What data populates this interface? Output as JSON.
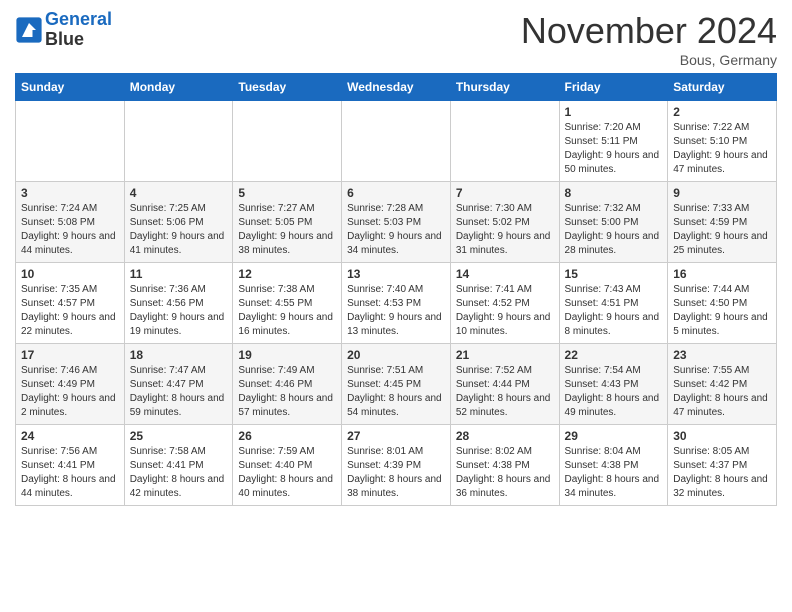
{
  "header": {
    "logo_line1": "General",
    "logo_line2": "Blue",
    "title": "November 2024",
    "location": "Bous, Germany"
  },
  "weekdays": [
    "Sunday",
    "Monday",
    "Tuesday",
    "Wednesday",
    "Thursday",
    "Friday",
    "Saturday"
  ],
  "weeks": [
    [
      {
        "day": "",
        "info": ""
      },
      {
        "day": "",
        "info": ""
      },
      {
        "day": "",
        "info": ""
      },
      {
        "day": "",
        "info": ""
      },
      {
        "day": "",
        "info": ""
      },
      {
        "day": "1",
        "info": "Sunrise: 7:20 AM\nSunset: 5:11 PM\nDaylight: 9 hours and 50 minutes."
      },
      {
        "day": "2",
        "info": "Sunrise: 7:22 AM\nSunset: 5:10 PM\nDaylight: 9 hours and 47 minutes."
      }
    ],
    [
      {
        "day": "3",
        "info": "Sunrise: 7:24 AM\nSunset: 5:08 PM\nDaylight: 9 hours and 44 minutes."
      },
      {
        "day": "4",
        "info": "Sunrise: 7:25 AM\nSunset: 5:06 PM\nDaylight: 9 hours and 41 minutes."
      },
      {
        "day": "5",
        "info": "Sunrise: 7:27 AM\nSunset: 5:05 PM\nDaylight: 9 hours and 38 minutes."
      },
      {
        "day": "6",
        "info": "Sunrise: 7:28 AM\nSunset: 5:03 PM\nDaylight: 9 hours and 34 minutes."
      },
      {
        "day": "7",
        "info": "Sunrise: 7:30 AM\nSunset: 5:02 PM\nDaylight: 9 hours and 31 minutes."
      },
      {
        "day": "8",
        "info": "Sunrise: 7:32 AM\nSunset: 5:00 PM\nDaylight: 9 hours and 28 minutes."
      },
      {
        "day": "9",
        "info": "Sunrise: 7:33 AM\nSunset: 4:59 PM\nDaylight: 9 hours and 25 minutes."
      }
    ],
    [
      {
        "day": "10",
        "info": "Sunrise: 7:35 AM\nSunset: 4:57 PM\nDaylight: 9 hours and 22 minutes."
      },
      {
        "day": "11",
        "info": "Sunrise: 7:36 AM\nSunset: 4:56 PM\nDaylight: 9 hours and 19 minutes."
      },
      {
        "day": "12",
        "info": "Sunrise: 7:38 AM\nSunset: 4:55 PM\nDaylight: 9 hours and 16 minutes."
      },
      {
        "day": "13",
        "info": "Sunrise: 7:40 AM\nSunset: 4:53 PM\nDaylight: 9 hours and 13 minutes."
      },
      {
        "day": "14",
        "info": "Sunrise: 7:41 AM\nSunset: 4:52 PM\nDaylight: 9 hours and 10 minutes."
      },
      {
        "day": "15",
        "info": "Sunrise: 7:43 AM\nSunset: 4:51 PM\nDaylight: 9 hours and 8 minutes."
      },
      {
        "day": "16",
        "info": "Sunrise: 7:44 AM\nSunset: 4:50 PM\nDaylight: 9 hours and 5 minutes."
      }
    ],
    [
      {
        "day": "17",
        "info": "Sunrise: 7:46 AM\nSunset: 4:49 PM\nDaylight: 9 hours and 2 minutes."
      },
      {
        "day": "18",
        "info": "Sunrise: 7:47 AM\nSunset: 4:47 PM\nDaylight: 8 hours and 59 minutes."
      },
      {
        "day": "19",
        "info": "Sunrise: 7:49 AM\nSunset: 4:46 PM\nDaylight: 8 hours and 57 minutes."
      },
      {
        "day": "20",
        "info": "Sunrise: 7:51 AM\nSunset: 4:45 PM\nDaylight: 8 hours and 54 minutes."
      },
      {
        "day": "21",
        "info": "Sunrise: 7:52 AM\nSunset: 4:44 PM\nDaylight: 8 hours and 52 minutes."
      },
      {
        "day": "22",
        "info": "Sunrise: 7:54 AM\nSunset: 4:43 PM\nDaylight: 8 hours and 49 minutes."
      },
      {
        "day": "23",
        "info": "Sunrise: 7:55 AM\nSunset: 4:42 PM\nDaylight: 8 hours and 47 minutes."
      }
    ],
    [
      {
        "day": "24",
        "info": "Sunrise: 7:56 AM\nSunset: 4:41 PM\nDaylight: 8 hours and 44 minutes."
      },
      {
        "day": "25",
        "info": "Sunrise: 7:58 AM\nSunset: 4:41 PM\nDaylight: 8 hours and 42 minutes."
      },
      {
        "day": "26",
        "info": "Sunrise: 7:59 AM\nSunset: 4:40 PM\nDaylight: 8 hours and 40 minutes."
      },
      {
        "day": "27",
        "info": "Sunrise: 8:01 AM\nSunset: 4:39 PM\nDaylight: 8 hours and 38 minutes."
      },
      {
        "day": "28",
        "info": "Sunrise: 8:02 AM\nSunset: 4:38 PM\nDaylight: 8 hours and 36 minutes."
      },
      {
        "day": "29",
        "info": "Sunrise: 8:04 AM\nSunset: 4:38 PM\nDaylight: 8 hours and 34 minutes."
      },
      {
        "day": "30",
        "info": "Sunrise: 8:05 AM\nSunset: 4:37 PM\nDaylight: 8 hours and 32 minutes."
      }
    ]
  ]
}
